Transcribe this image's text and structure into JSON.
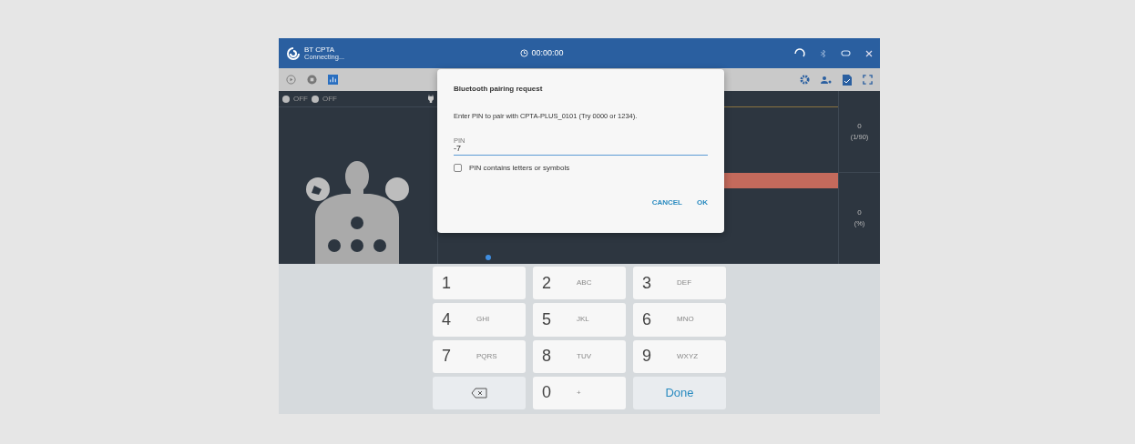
{
  "title_bar": {
    "app_name": "BT CPTA",
    "status": "Connecting...",
    "timer": "00:00:00"
  },
  "sensors": [
    {
      "label": "OFF"
    },
    {
      "label": "OFF"
    }
  ],
  "readings": [
    {
      "value": "0",
      "unit": "(1/90)"
    },
    {
      "value": "0",
      "unit": "(%)"
    }
  ],
  "dialog": {
    "title": "Bluetooth pairing request",
    "message": "Enter PIN to pair with CPTA-PLUS_0101 (Try 0000 or 1234).",
    "field": {
      "label": "PIN",
      "value": "-7"
    },
    "checkbox": {
      "label": "PIN contains letters or symbols",
      "checked": false
    },
    "buttons": [
      "CANCEL",
      "OK"
    ]
  },
  "keypad": [
    {
      "kind": "digit",
      "digit": "1"
    },
    {
      "kind": "digit",
      "digit": "2",
      "letters": "ABC"
    },
    {
      "kind": "digit",
      "digit": "3",
      "letters": "DEF"
    },
    {
      "kind": "digit",
      "digit": "4",
      "letters": "GHI"
    },
    {
      "kind": "digit",
      "digit": "5",
      "letters": "JKL"
    },
    {
      "kind": "digit",
      "digit": "6",
      "letters": "MNO"
    },
    {
      "kind": "digit",
      "digit": "7",
      "letters": "PQRS"
    },
    {
      "kind": "digit",
      "digit": "8",
      "letters": "TUV"
    },
    {
      "kind": "digit",
      "digit": "9",
      "letters": "WXYZ"
    },
    {
      "kind": "backspace"
    },
    {
      "kind": "digit",
      "digit": "0",
      "letters": "+"
    },
    {
      "kind": "action",
      "label": "Done"
    }
  ]
}
